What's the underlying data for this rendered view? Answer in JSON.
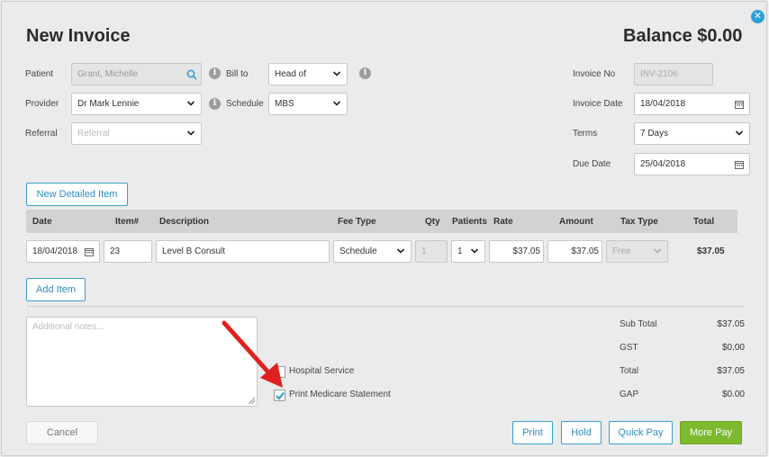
{
  "header": {
    "title": "New Invoice",
    "balance": "Balance $0.00"
  },
  "form": {
    "patient": {
      "label": "Patient",
      "value": "Grant, Michelle"
    },
    "provider": {
      "label": "Provider",
      "value": "Dr Mark Lennie"
    },
    "referral": {
      "label": "Referral",
      "placeholder": "Referral"
    },
    "bill_to": {
      "label": "Bill to",
      "value": "Head of"
    },
    "schedule": {
      "label": "Schedule",
      "value": "MBS"
    },
    "invoice_no": {
      "label": "Invoice No",
      "value": "INV-2106"
    },
    "invoice_date": {
      "label": "Invoice Date",
      "value": "18/04/2018"
    },
    "terms": {
      "label": "Terms",
      "value": "7 Days"
    },
    "due_date": {
      "label": "Due Date",
      "value": "25/04/2018"
    }
  },
  "buttons": {
    "new_detailed_item": "New Detailed Item",
    "add_item": "Add Item",
    "cancel": "Cancel",
    "print": "Print",
    "hold": "Hold",
    "quick_pay": "Quick Pay",
    "more_pay": "More Pay"
  },
  "table": {
    "columns": [
      "Date",
      "Item#",
      "Description",
      "Fee Type",
      "Qty",
      "Patients",
      "Rate",
      "Amount",
      "Tax Type",
      "Total"
    ],
    "rows": [
      {
        "date": "18/04/2018",
        "item": "23",
        "description": "Level B Consult",
        "fee_type": "Schedule",
        "qty": "1",
        "patients": "1",
        "rate": "$37.05",
        "amount": "$37.05",
        "tax_type": "Free",
        "total": "$37.05"
      }
    ]
  },
  "notes": {
    "placeholder": "Additional notes..."
  },
  "options": {
    "hospital_service": {
      "label": "Hospital Service",
      "checked": false
    },
    "print_medicare_statement": {
      "label": "Print Medicare Statement",
      "checked": true
    }
  },
  "totals": {
    "sub_total": {
      "label": "Sub Total",
      "value": "$37.05"
    },
    "gst": {
      "label": "GST",
      "value": "$0.00"
    },
    "total": {
      "label": "Total",
      "value": "$37.05"
    },
    "gap": {
      "label": "GAP",
      "value": "$0.00"
    }
  },
  "colors": {
    "accent": "#2a8ec0",
    "primary_button": "#7dba2f",
    "annotation_arrow": "#e02020"
  },
  "icons": {
    "close": "close-icon",
    "search": "search-icon",
    "info": "info-icon",
    "dropdown": "chevron-down-icon",
    "calendar": "calendar-icon",
    "checkmark": "checkmark-icon",
    "arrow": "red-arrow-annotation"
  }
}
